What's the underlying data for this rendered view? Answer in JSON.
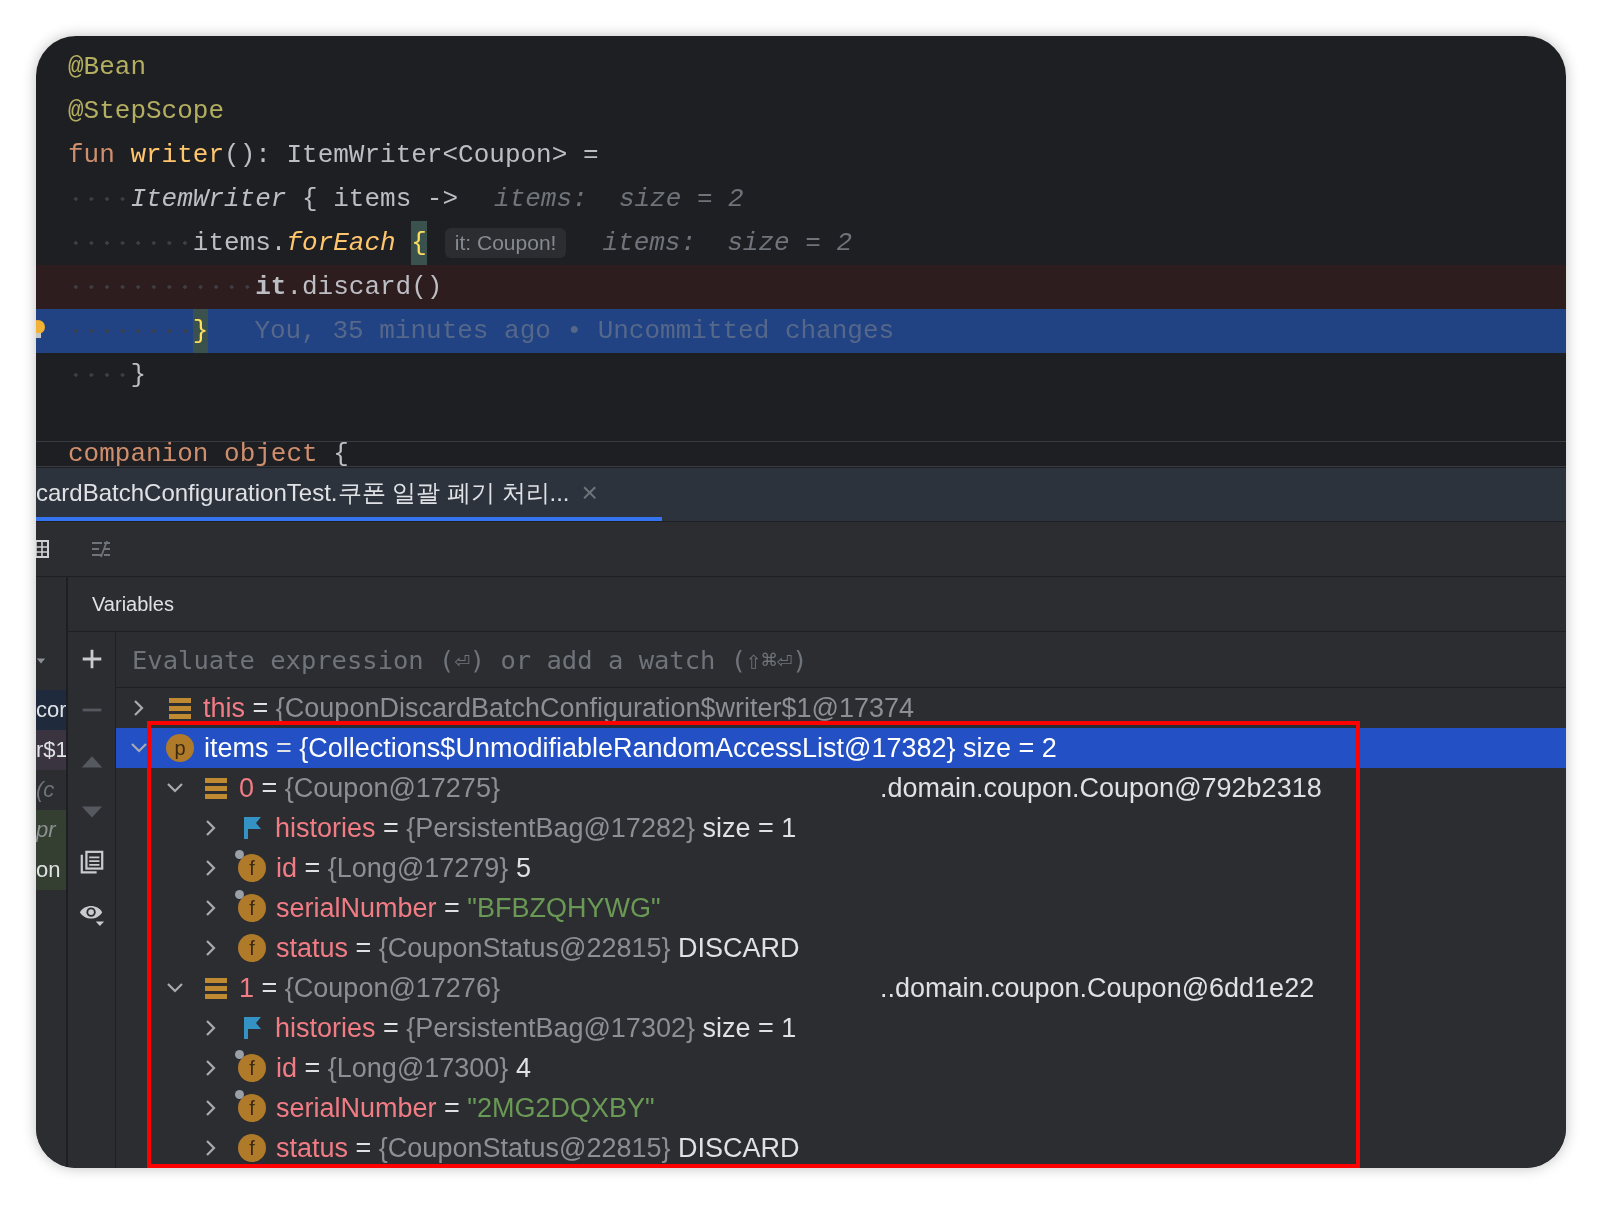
{
  "editor": {
    "lines": [
      {
        "kind": "normal",
        "tokens": [
          {
            "kind": "annotation",
            "text": "@Bean"
          }
        ]
      },
      {
        "kind": "normal",
        "tokens": [
          {
            "kind": "annotation",
            "text": "@StepScope"
          }
        ]
      },
      {
        "kind": "normal",
        "tokens": [
          {
            "kind": "keyword",
            "text": "fun"
          },
          {
            "kind": "function",
            "text": "writer"
          },
          {
            "kind": "plain",
            "text": "(): ItemWriter<Coupon> ="
          }
        ],
        "children": [
          {
            "kind": "normal",
            "tokens": [
              {
                "kind": "italic",
                "text": "ItemWriter"
              },
              {
                "kind": "plain",
                "text": " { items ->"
              },
              {
                "kind": "hint",
                "text": "items:  size = 2"
              }
            ],
            "children": [
              {
                "kind": "normal",
                "tokens": [
                  {
                    "kind": "plain",
                    "text": "items."
                  },
                  {
                    "kind": "function-italic",
                    "text": "forEach"
                  },
                  {
                    "kind": "brace-match",
                    "text": "{"
                  },
                  {
                    "kind": "chip",
                    "text": "it: Coupon!"
                  },
                  {
                    "kind": "hint",
                    "text": "items:  size = 2"
                  }
                ],
                "children": [
                  {
                    "kind": "breakpoint",
                    "tokens": [
                      {
                        "kind": "bold",
                        "text": "it"
                      },
                      {
                        "kind": "plain",
                        "text": ".discard()"
                      }
                    ]
                  }
                ]
              },
              {
                "kind": "execution",
                "bulb": true,
                "tokens": [
                  {
                    "kind": "brace-match",
                    "text": "}"
                  },
                  {
                    "kind": "blame",
                    "text": "You, 35 minutes ago • Uncommitted changes"
                  }
                ]
              }
            ]
          },
          {
            "kind": "normal",
            "tokens": [
              {
                "kind": "plain",
                "text": "}"
              }
            ]
          }
        ]
      },
      {
        "kind": "blank"
      },
      {
        "kind": "cut",
        "tokens": [
          {
            "kind": "keyword",
            "text": "companion object"
          },
          {
            "kind": "plain",
            "text": "{"
          }
        ]
      }
    ]
  },
  "session_tab": {
    "title": "cardBatchConfigurationTest.쿠폰 일괄 폐기 처리...",
    "close": "×",
    "selected": true
  },
  "frames": [
    {
      "kind": "current",
      "text": "cor"
    },
    {
      "kind": "marked",
      "text": "r$1"
    },
    {
      "kind": "library",
      "text": "(c"
    },
    {
      "kind": "test",
      "text": "pr"
    },
    {
      "kind": "test",
      "text": "on"
    }
  ],
  "variables": {
    "title": "Variables",
    "placeholder": "Evaluate expression (⏎) or add a watch (⇧⌘⏎)",
    "tools": [
      {
        "kind": "add",
        "disabled": false
      },
      {
        "kind": "remove",
        "disabled": true
      },
      {
        "kind": "up",
        "disabled": true
      },
      {
        "kind": "down",
        "disabled": true
      },
      {
        "kind": "copy",
        "disabled": false
      },
      {
        "kind": "watch",
        "disabled": false
      }
    ],
    "highlight_box": true,
    "items": [
      {
        "kind": "object",
        "name": "this",
        "operator": "=",
        "value": "{CouponDiscardBatchConfiguration$writer$1@17374",
        "expanded": false,
        "selected": false
      },
      {
        "kind": "badge",
        "badge": "p",
        "final": false,
        "name": "items",
        "operator": "=",
        "value": "{Collections$UnmodifiableRandomAccessList@17382}",
        "extra": "size = 2",
        "expanded": true,
        "selected": true,
        "children": [
          {
            "kind": "object",
            "name": "0",
            "operator": "=",
            "value": "{Coupon@17275}",
            "to_string": ".domain.coupon.Coupon@792b2318",
            "expanded": true,
            "selected": false,
            "children": [
              {
                "kind": "flag",
                "name": "histories",
                "operator": "=",
                "value": "{PersistentBag@17282}",
                "extra": "size = 1",
                "expanded": false,
                "selected": false
              },
              {
                "kind": "badge",
                "badge": "f",
                "final": true,
                "name": "id",
                "operator": "=",
                "value": "{Long@17279}",
                "extra": "5",
                "expanded": false,
                "selected": false
              },
              {
                "kind": "badge",
                "badge": "f",
                "final": true,
                "name": "serialNumber",
                "operator": "=",
                "string": "\"BFBZQHYWG\"",
                "expanded": false,
                "selected": false
              },
              {
                "kind": "badge",
                "badge": "f",
                "final": false,
                "name": "status",
                "operator": "=",
                "value": "{CouponStatus@22815}",
                "extra": "DISCARD",
                "expanded": false,
                "selected": false
              }
            ]
          },
          {
            "kind": "object",
            "name": "1",
            "operator": "=",
            "value": "{Coupon@17276}",
            "to_string": "..domain.coupon.Coupon@6dd1e22",
            "expanded": true,
            "selected": false,
            "children": [
              {
                "kind": "flag",
                "name": "histories",
                "operator": "=",
                "value": "{PersistentBag@17302}",
                "extra": "size = 1",
                "expanded": false,
                "selected": false
              },
              {
                "kind": "badge",
                "badge": "f",
                "final": true,
                "name": "id",
                "operator": "=",
                "value": "{Long@17300}",
                "extra": "4",
                "expanded": false,
                "selected": false
              },
              {
                "kind": "badge",
                "badge": "f",
                "final": true,
                "name": "serialNumber",
                "operator": "=",
                "string": "\"2MG2DQXBY\"",
                "expanded": false,
                "selected": false
              },
              {
                "kind": "badge",
                "badge": "f",
                "final": false,
                "name": "status",
                "operator": "=",
                "value": "{CouponStatus@22815}",
                "extra": "DISCARD",
                "expanded": false,
                "selected": false
              }
            ]
          }
        ]
      }
    ]
  }
}
